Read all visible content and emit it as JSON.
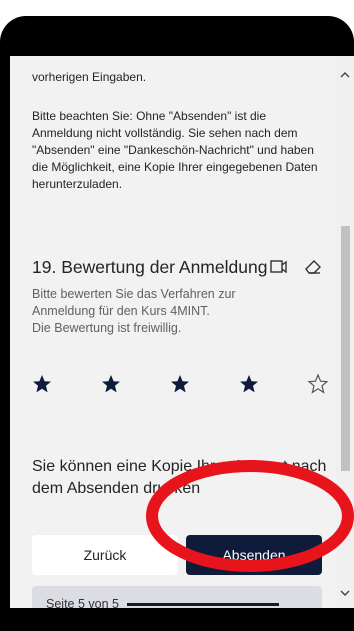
{
  "form": {
    "intro_top": "vorherigen Eingaben.",
    "notice": "Bitte beachten Sie: Ohne \"Absenden\" ist die Anmeldung nicht vollständig. Sie sehen nach dem \"Absenden\" eine \"Dankeschön-Nachricht\" und haben die Möglichkeit, eine Kopie Ihrer eingegebenen Daten herunterzuladen.",
    "question_title": "19. Bewertung der Anmeldung",
    "question_desc_1": "Bitte bewerten Sie das Verfahren zur",
    "question_desc_2": "Anmeldung für den Kurs 4MINT.",
    "question_desc_3": "Die Bewertung ist freiwillig.",
    "rating": {
      "value": 4,
      "max": 5
    },
    "copy_note": "Sie können eine Kopie Ihrer Antwort nach dem Absenden drucken",
    "back_label": "Zurück",
    "submit_label": "Absenden",
    "progress_text": "Seite 5 von 5",
    "progress_fraction": 1.0
  },
  "colors": {
    "submit_bg": "#0f1b3a",
    "annotation": "#e8141c",
    "background": "#f2f2f2"
  },
  "icons": {
    "question": [
      "immersive-reader-icon",
      "eraser-icon"
    ],
    "rating": "star-icon",
    "scroll": [
      "chevron-up-icon",
      "chevron-down-icon"
    ]
  }
}
